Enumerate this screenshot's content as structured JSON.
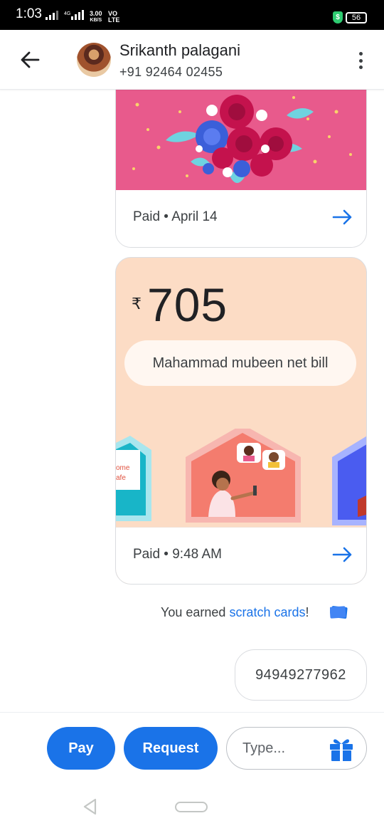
{
  "status_bar": {
    "time": "1:03",
    "network_small": "4G",
    "speed_value": "3.00",
    "speed_unit": "KB/S",
    "volte_top": "VO",
    "volte_bottom": "LTE",
    "battery": "56"
  },
  "header": {
    "contact_name": "Srikanth palagani",
    "contact_phone": "+91 92464 02455"
  },
  "messages": [
    {
      "type": "payment_card",
      "status": "Paid • April 14"
    },
    {
      "type": "payment_card",
      "currency_symbol": "₹",
      "amount": "705",
      "note": "Mahammad mubeen net bill",
      "illustration_text": "ome\nafe",
      "status": "Paid • 9:48 AM"
    }
  ],
  "reward": {
    "prefix": "You earned ",
    "link": "scratch cards",
    "suffix": "!"
  },
  "sent_message": "94949277962",
  "composer": {
    "pay_label": "Pay",
    "request_label": "Request",
    "input_placeholder": "Type..."
  },
  "colors": {
    "accent": "#1a73e8",
    "card1_background": "#e85a8c",
    "card2_background": "#fcdcc5"
  },
  "icons": {
    "back": "arrow-left-icon",
    "menu": "more-vert-icon",
    "card_arrow": "arrow-right-icon",
    "scratch": "scratch-card-icon",
    "gift": "gift-icon"
  }
}
